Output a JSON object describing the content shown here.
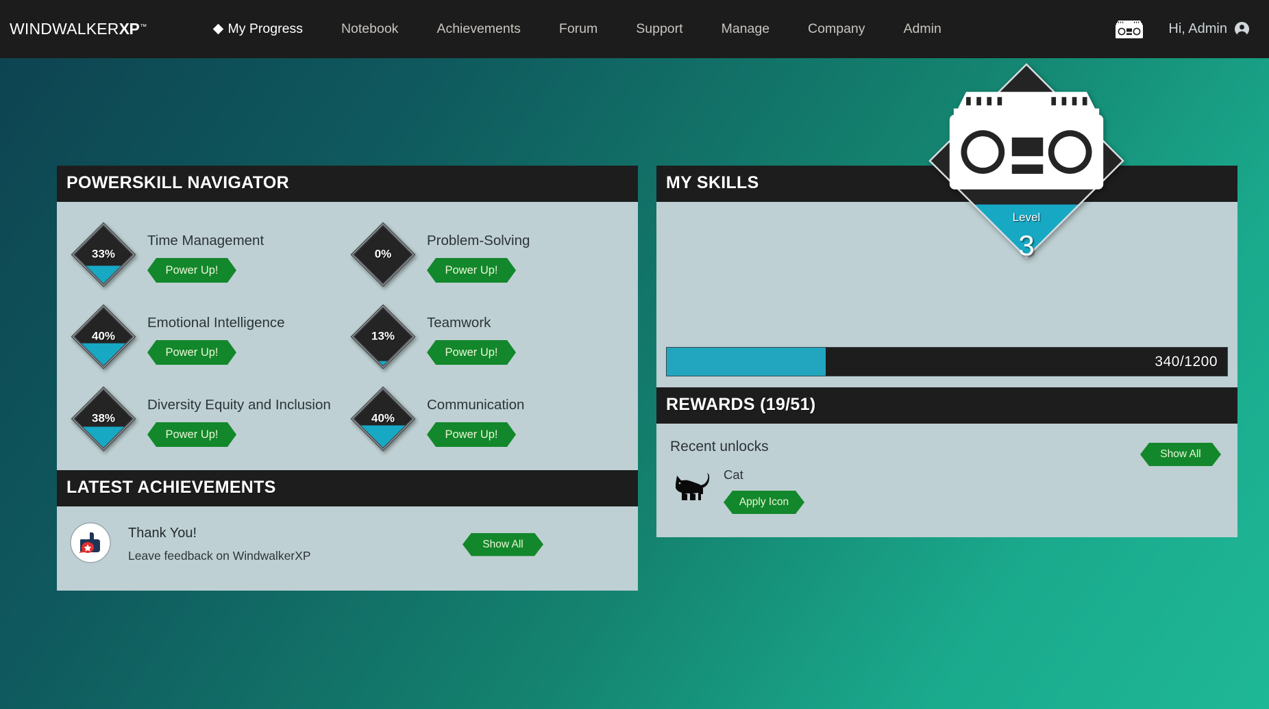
{
  "app": {
    "logo_main": "WINDWALKER",
    "logo_xp": "XP",
    "logo_tm": "™"
  },
  "nav": {
    "items": [
      {
        "label": "My Progress",
        "active": true
      },
      {
        "label": "Notebook",
        "active": false
      },
      {
        "label": "Achievements",
        "active": false
      },
      {
        "label": "Forum",
        "active": false
      },
      {
        "label": "Support",
        "active": false
      },
      {
        "label": "Manage",
        "active": false
      },
      {
        "label": "Company",
        "active": false
      },
      {
        "label": "Admin",
        "active": false
      }
    ],
    "boombox_icon": "boombox-icon",
    "greeting": "Hi, Admin",
    "avatar_icon": "user-avatar-icon"
  },
  "powerskill": {
    "title": "POWERSKILL NAVIGATOR",
    "skills": [
      {
        "name": "Time Management",
        "percent": 33,
        "percent_label": "33%",
        "button": "Power Up!"
      },
      {
        "name": "Problem-Solving",
        "percent": 0,
        "percent_label": "0%",
        "button": "Power Up!"
      },
      {
        "name": "Emotional Intelligence",
        "percent": 40,
        "percent_label": "40%",
        "button": "Power Up!"
      },
      {
        "name": "Teamwork",
        "percent": 13,
        "percent_label": "13%",
        "button": "Power Up!"
      },
      {
        "name": "Diversity Equity and Inclusion",
        "percent": 38,
        "percent_label": "38%",
        "button": "Power Up!"
      },
      {
        "name": "Communication",
        "percent": 40,
        "percent_label": "40%",
        "button": "Power Up!"
      }
    ]
  },
  "achievements": {
    "title": "LATEST ACHIEVEMENTS",
    "icon": "thumbs-up-badge-icon",
    "item_title": "Thank You!",
    "item_desc": "Leave feedback on WindwalkerXP",
    "show_all_label": "Show All"
  },
  "myskills": {
    "title": "MY SKILLS",
    "level_word": "Level",
    "level_value": "3",
    "level_icon": "boombox-icon",
    "xp_current": 340,
    "xp_max": 1200,
    "xp_label": "340/1200",
    "xp_percent": 28
  },
  "rewards": {
    "title": "REWARDS (19/51)",
    "unlocked_count": 19,
    "total_count": 51,
    "subtitle": "Recent unlocks",
    "item_icon": "cat-icon",
    "item_name": "Cat",
    "apply_label": "Apply Icon",
    "show_all_label": "Show All"
  },
  "colors": {
    "accent_cyan": "#22a6c0",
    "button_green": "#13872b",
    "panel_dark": "#1d1d1d",
    "panel_body": "#bed0d3",
    "bg_start": "#0d4250",
    "bg_end": "#1eb896"
  }
}
